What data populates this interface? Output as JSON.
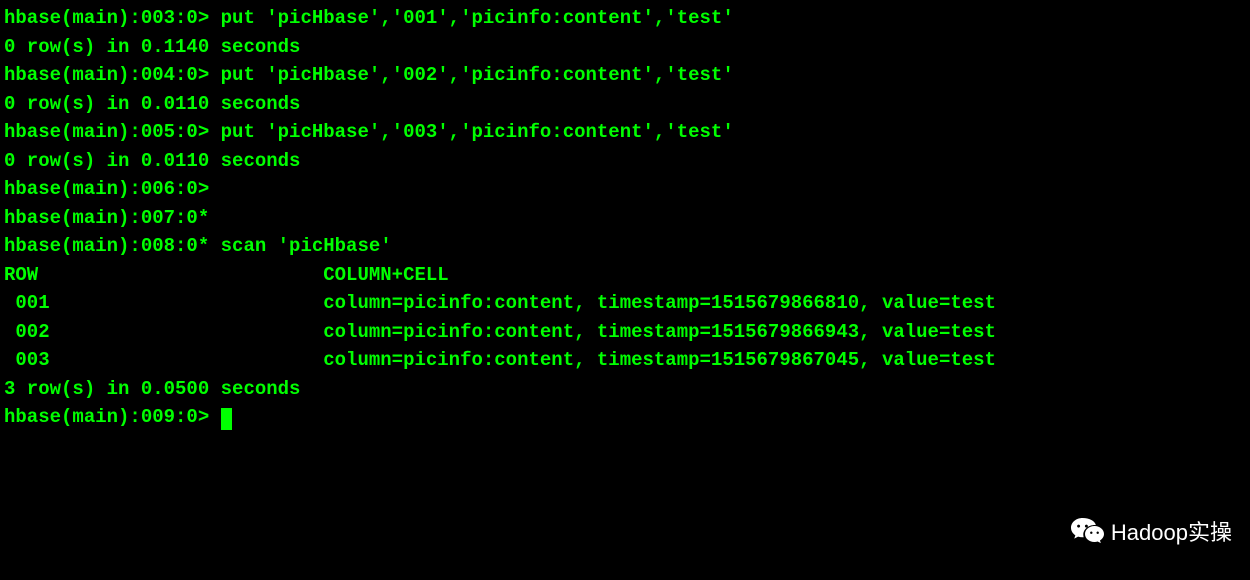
{
  "lines": {
    "l1": "hbase(main):003:0> put 'picHbase','001','picinfo:content','test'",
    "l2": "0 row(s) in 0.1140 seconds",
    "l3": "",
    "l4": "hbase(main):004:0> put 'picHbase','002','picinfo:content','test'",
    "l5": "0 row(s) in 0.0110 seconds",
    "l6": "",
    "l7": "hbase(main):005:0> put 'picHbase','003','picinfo:content','test'",
    "l8": "0 row(s) in 0.0110 seconds",
    "l9": "",
    "l10": "hbase(main):006:0>",
    "l11": "hbase(main):007:0*",
    "l12": "hbase(main):008:0* scan 'picHbase'",
    "l13": "ROW                         COLUMN+CELL",
    "l14": " 001                        column=picinfo:content, timestamp=1515679866810, value=test",
    "l15": " 002                        column=picinfo:content, timestamp=1515679866943, value=test",
    "l16": " 003                        column=picinfo:content, timestamp=1515679867045, value=test",
    "l17": "3 row(s) in 0.0500 seconds",
    "l18": "",
    "l19": "hbase(main):009:0> "
  },
  "watermark": {
    "text": "Hadoop实操"
  }
}
